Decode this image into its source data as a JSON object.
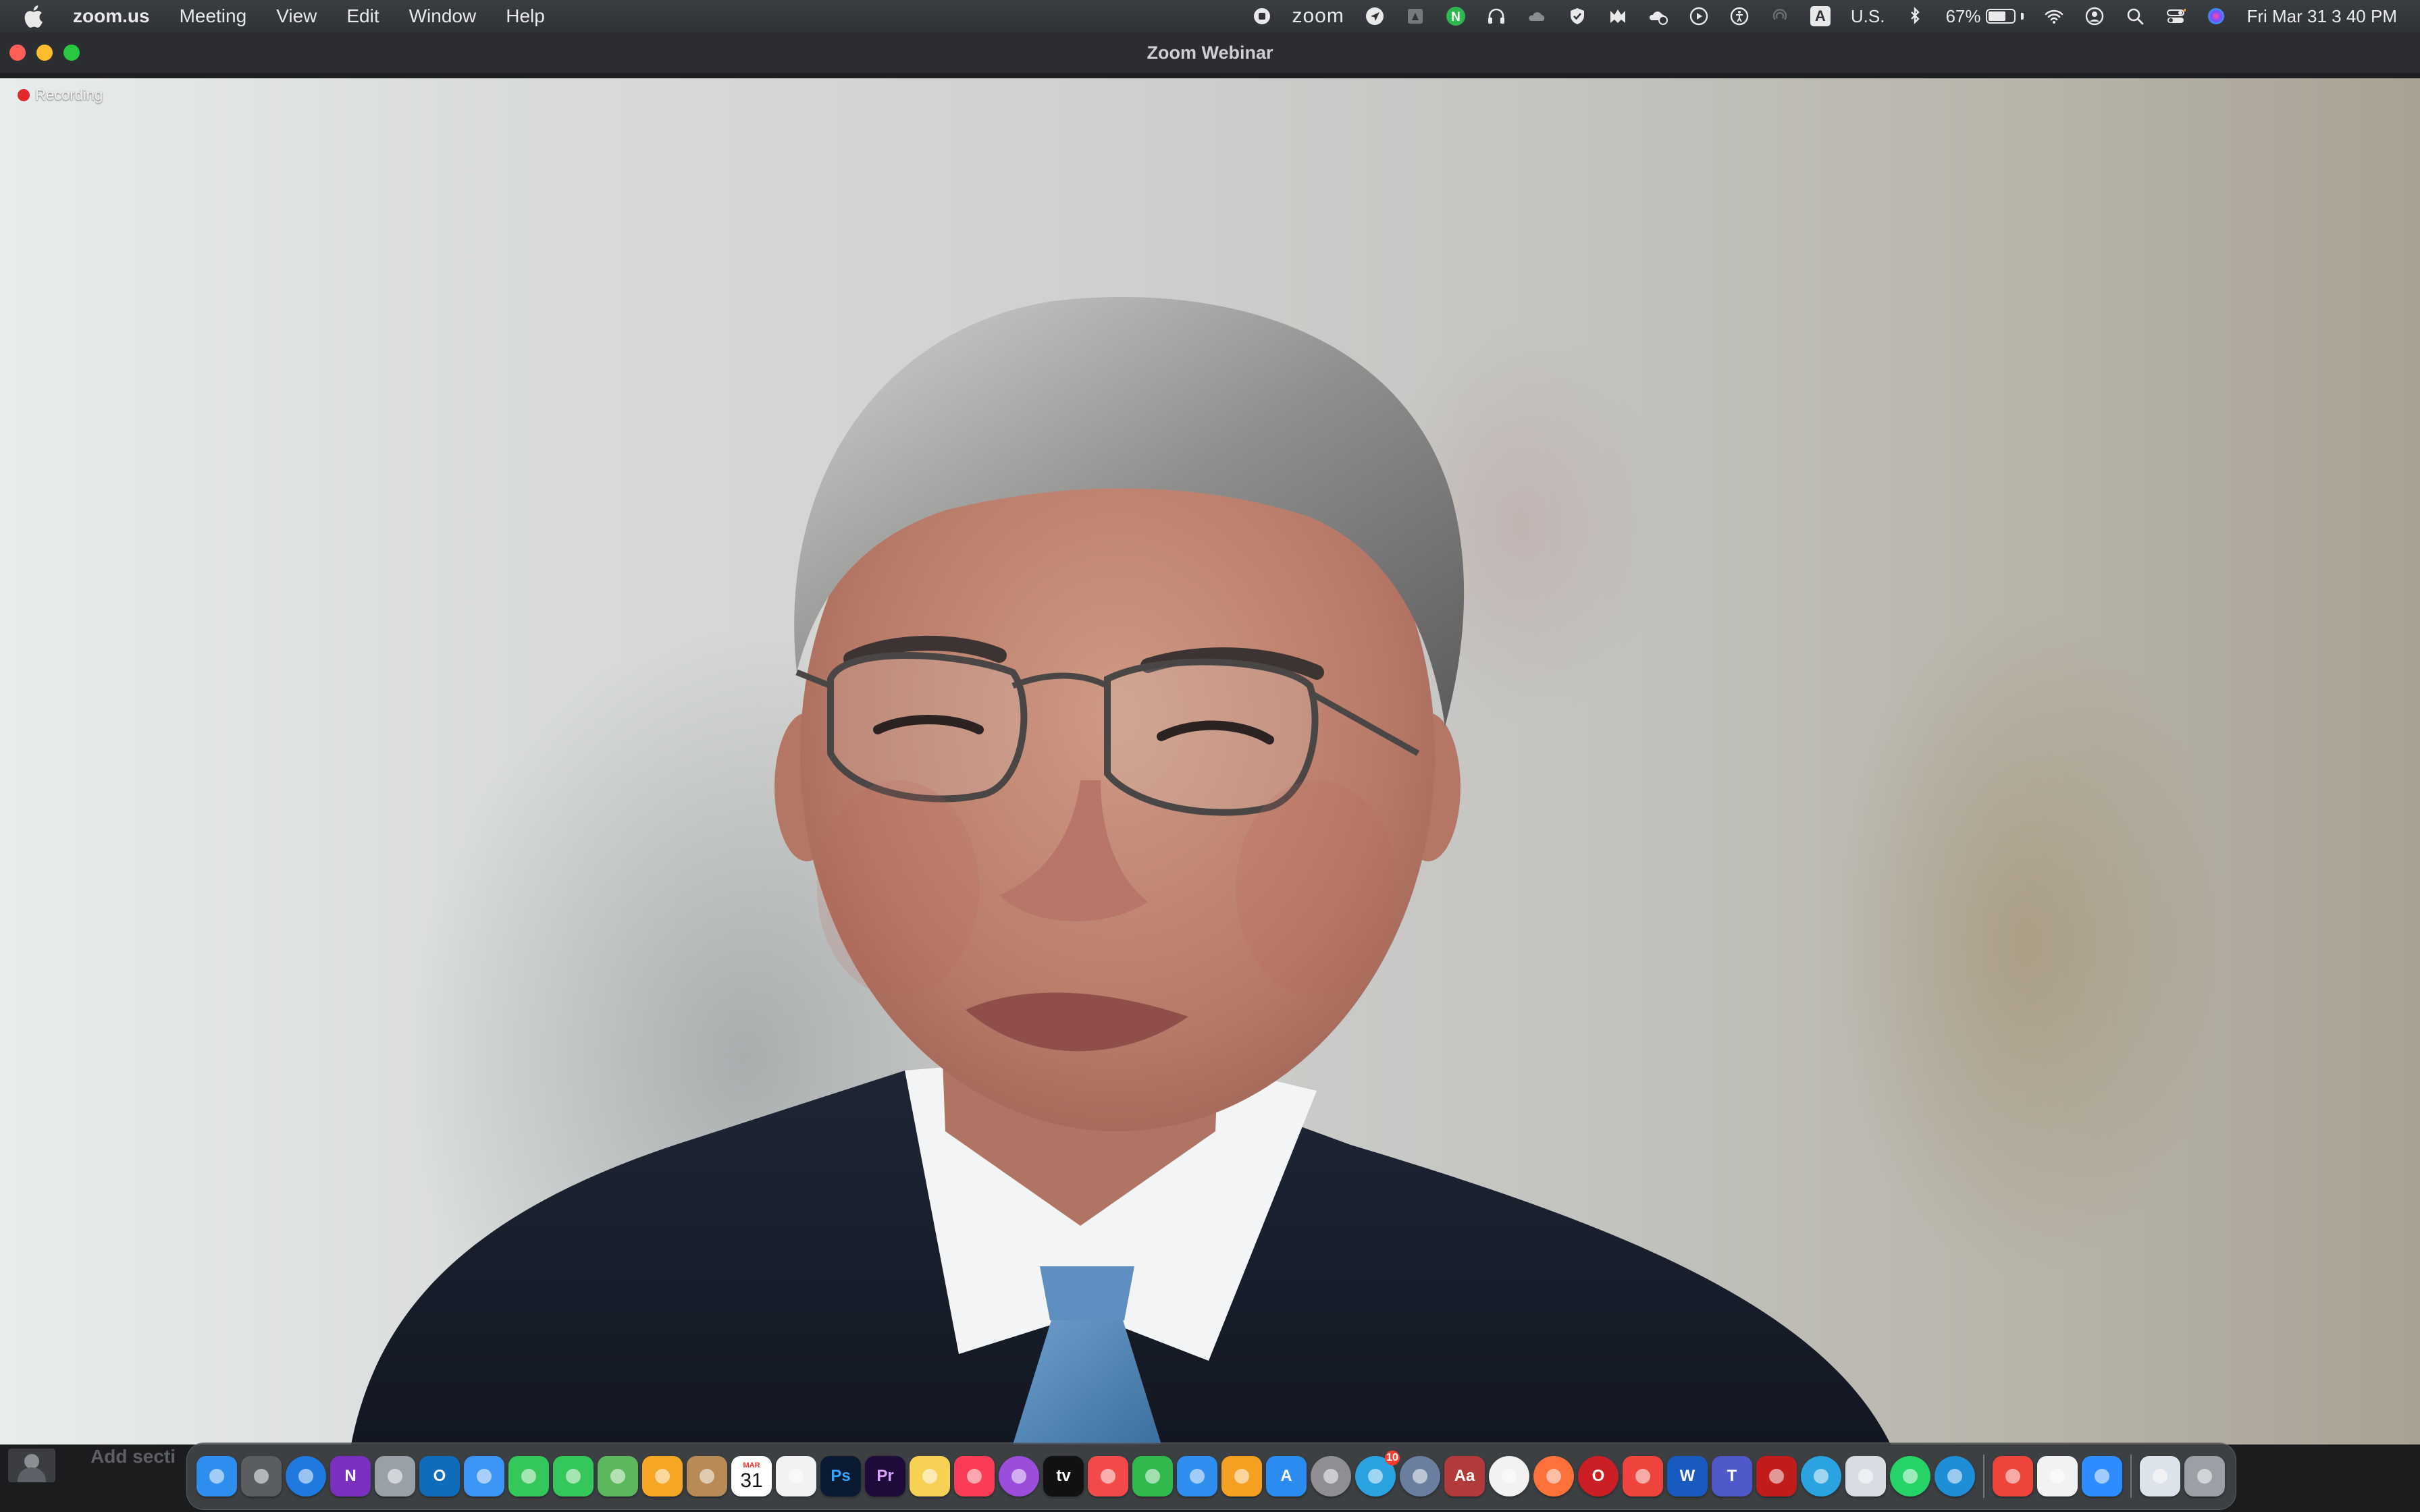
{
  "menubar": {
    "app_name": "zoom.us",
    "menus": [
      "Meeting",
      "View",
      "Edit",
      "Window",
      "Help"
    ],
    "zoom_label": "zoom",
    "keyboard_badge": "A",
    "keyboard_layout": "U.S.",
    "battery_percent": "67%",
    "battery_level": 0.67,
    "clock": "Fri Mar 31  3 40 PM"
  },
  "window": {
    "title": "Zoom Webinar"
  },
  "video": {
    "recording_label": "Recording"
  },
  "bottom": {
    "add_section_label": "Add secti"
  },
  "dock": {
    "calendar_month": "MAR",
    "calendar_day": "31",
    "telegram_badge": "10",
    "items": [
      {
        "name": "finder",
        "label": "",
        "color": "#2e8ef0"
      },
      {
        "name": "screenshot",
        "label": "",
        "color": "#5a5d62"
      },
      {
        "name": "safari",
        "label": "",
        "color": "#1f7ae0"
      },
      {
        "name": "onenote",
        "label": "N",
        "color": "#7b2fbf"
      },
      {
        "name": "launchpad",
        "label": "",
        "color": "#9aa0a8"
      },
      {
        "name": "outlook",
        "label": "O",
        "color": "#0f6cbd"
      },
      {
        "name": "mail",
        "label": "",
        "color": "#3b95f5"
      },
      {
        "name": "facetime",
        "label": "",
        "color": "#34c759"
      },
      {
        "name": "messages",
        "label": "",
        "color": "#34c759"
      },
      {
        "name": "maps",
        "label": "",
        "color": "#5cb85c"
      },
      {
        "name": "photos",
        "label": "",
        "color": "#f5a623"
      },
      {
        "name": "contacts",
        "label": "",
        "color": "#b88a55"
      },
      {
        "name": "calendar",
        "label": "",
        "color": "#ffffff"
      },
      {
        "name": "reminders",
        "label": "",
        "color": "#f2f2f2"
      },
      {
        "name": "photoshop",
        "label": "Ps",
        "color": "#0a1a33"
      },
      {
        "name": "premiere",
        "label": "Pr",
        "color": "#1f0b3a"
      },
      {
        "name": "notes",
        "label": "",
        "color": "#f7d154"
      },
      {
        "name": "music",
        "label": "",
        "color": "#fa3c56"
      },
      {
        "name": "podcasts",
        "label": "",
        "color": "#9b4ddb"
      },
      {
        "name": "apple-tv",
        "label": "tv",
        "color": "#111111"
      },
      {
        "name": "news",
        "label": "",
        "color": "#f24a4a"
      },
      {
        "name": "numbers",
        "label": "",
        "color": "#31b94d"
      },
      {
        "name": "keynote",
        "label": "",
        "color": "#2f8ff0"
      },
      {
        "name": "pages",
        "label": "",
        "color": "#f5a020"
      },
      {
        "name": "app-store",
        "label": "A",
        "color": "#2a8cf0"
      },
      {
        "name": "system-settings",
        "label": "",
        "color": "#8e8e93"
      },
      {
        "name": "telegram",
        "label": "",
        "color": "#2aa3e0"
      },
      {
        "name": "preview-search",
        "label": "",
        "color": "#6a7fa0"
      },
      {
        "name": "dictionary",
        "label": "Aa",
        "color": "#b23a3a"
      },
      {
        "name": "chrome",
        "label": "",
        "color": "#f2f2f2"
      },
      {
        "name": "firefox",
        "label": "",
        "color": "#ff7139"
      },
      {
        "name": "opera",
        "label": "O",
        "color": "#cc1f25"
      },
      {
        "name": "anydesk",
        "label": "",
        "color": "#ef443b"
      },
      {
        "name": "word",
        "label": "W",
        "color": "#185abd"
      },
      {
        "name": "teams",
        "label": "T",
        "color": "#5059c9"
      },
      {
        "name": "acrobat",
        "label": "",
        "color": "#c01c1c"
      },
      {
        "name": "telegram-2",
        "label": "",
        "color": "#2aa3e0"
      },
      {
        "name": "preview",
        "label": "",
        "color": "#d8dde3"
      },
      {
        "name": "whatsapp",
        "label": "",
        "color": "#25d366"
      },
      {
        "name": "edge",
        "label": "",
        "color": "#1e8fd6"
      },
      {
        "name": "anydesk-2",
        "label": "",
        "color": "#ef443b"
      },
      {
        "name": "google-drive",
        "label": "",
        "color": "#f2f2f2"
      },
      {
        "name": "zoom",
        "label": "",
        "color": "#2d8cff"
      },
      {
        "name": "screenshot-folder",
        "label": "",
        "color": "#dde3ea"
      },
      {
        "name": "trash",
        "label": "",
        "color": "#9aa0a6"
      }
    ]
  }
}
